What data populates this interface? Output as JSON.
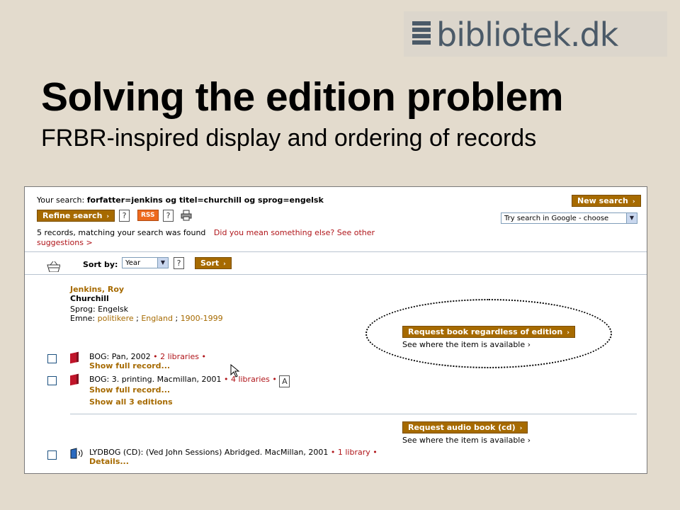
{
  "logo": {
    "text": "bibliotek.dk"
  },
  "slide": {
    "title": "Solving the edition problem",
    "subtitle": "FRBR-inspired display and ordering of records"
  },
  "search": {
    "label": "Your search:",
    "query": "forfatter=jenkins og titel=churchill og sprog=engelsk",
    "new_search": "New search",
    "refine": "Refine search",
    "help_q": "?",
    "rss": "RSS",
    "google_select": "Try search in Google - choose",
    "results_text": "5 records, matching your search was found",
    "did_you_mean": "Did you mean something else? See other",
    "suggestions": "suggestions >"
  },
  "sort": {
    "label": "Sort by:",
    "value": "Year",
    "button": "Sort"
  },
  "record": {
    "author": "Jenkins, Roy",
    "title": "Churchill",
    "language": "Sprog: Engelsk",
    "subject_label": "Emne:",
    "subjects": [
      "politikere",
      "England",
      "1900-1999"
    ],
    "request_book": "Request book regardless of edition",
    "see_where_1": "See where the item is available",
    "editions": [
      {
        "text": "BOG: Pan, 2002",
        "libraries": "2 libraries",
        "show": "Show full record..."
      },
      {
        "text": "BOG: 3. printing. Macmillan, 2001",
        "libraries": "4 libraries",
        "badge": "A",
        "show": "Show full record..."
      }
    ],
    "show_all": "Show all 3 editions",
    "request_audio": "Request audio book (cd)",
    "see_where_2": "See where the item is available",
    "audio": {
      "text": "LYDBOG (CD): (Ved John Sessions) Abridged. MacMillan, 2001",
      "libraries": "1 library",
      "details": "Details..."
    }
  },
  "colors": {
    "button_bg": "#a66a00",
    "link_red": "#b0151a",
    "slide_bg": "#e3dbcd"
  }
}
